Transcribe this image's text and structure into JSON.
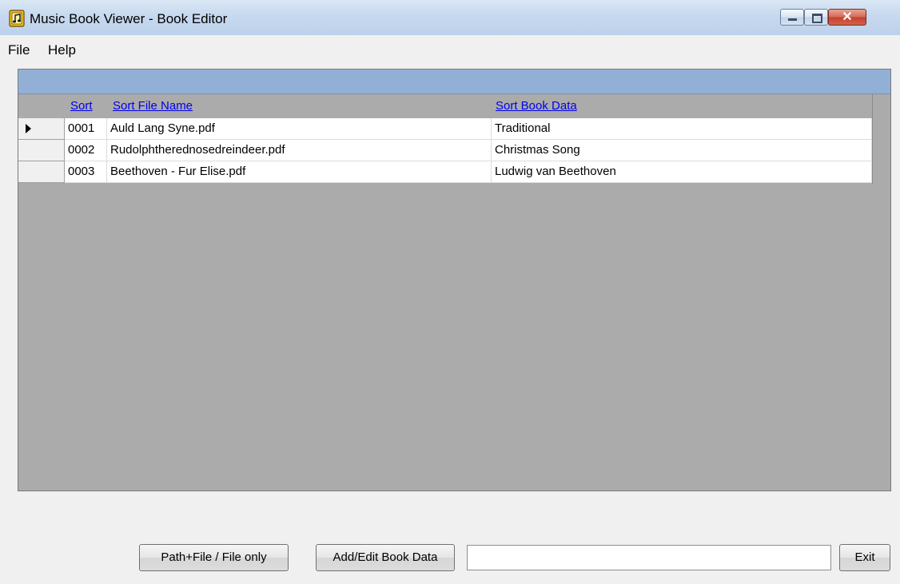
{
  "window": {
    "title": "Music Book Viewer - Book Editor",
    "close_glyph": "✕"
  },
  "menu": {
    "items": [
      {
        "label": "File"
      },
      {
        "label": "Help"
      }
    ]
  },
  "grid": {
    "columns": [
      {
        "label": "Sort"
      },
      {
        "label": "Sort File Name"
      },
      {
        "label": "Sort Book Data"
      }
    ],
    "rows": [
      {
        "sort": "0001",
        "file": "Auld Lang Syne.pdf",
        "book": "Traditional",
        "current": true
      },
      {
        "sort": "0002",
        "file": "Rudolphtherednosedreindeer.pdf",
        "book": "Christmas Song",
        "current": false
      },
      {
        "sort": "0003",
        "file": "Beethoven - Fur Elise.pdf",
        "book": "Ludwig van Beethoven",
        "current": false
      }
    ]
  },
  "footer": {
    "path_toggle_label": "Path+File  / File only",
    "add_edit_label": "Add/Edit Book Data",
    "input_value": "",
    "exit_label": "Exit"
  },
  "colors": {
    "grid_background": "#ababab",
    "caption_bar": "#92b0d6",
    "link_header": "#0000ee"
  },
  "icons": {
    "app": "music-book-icon",
    "current_row": "row-pointer-arrow-icon"
  }
}
